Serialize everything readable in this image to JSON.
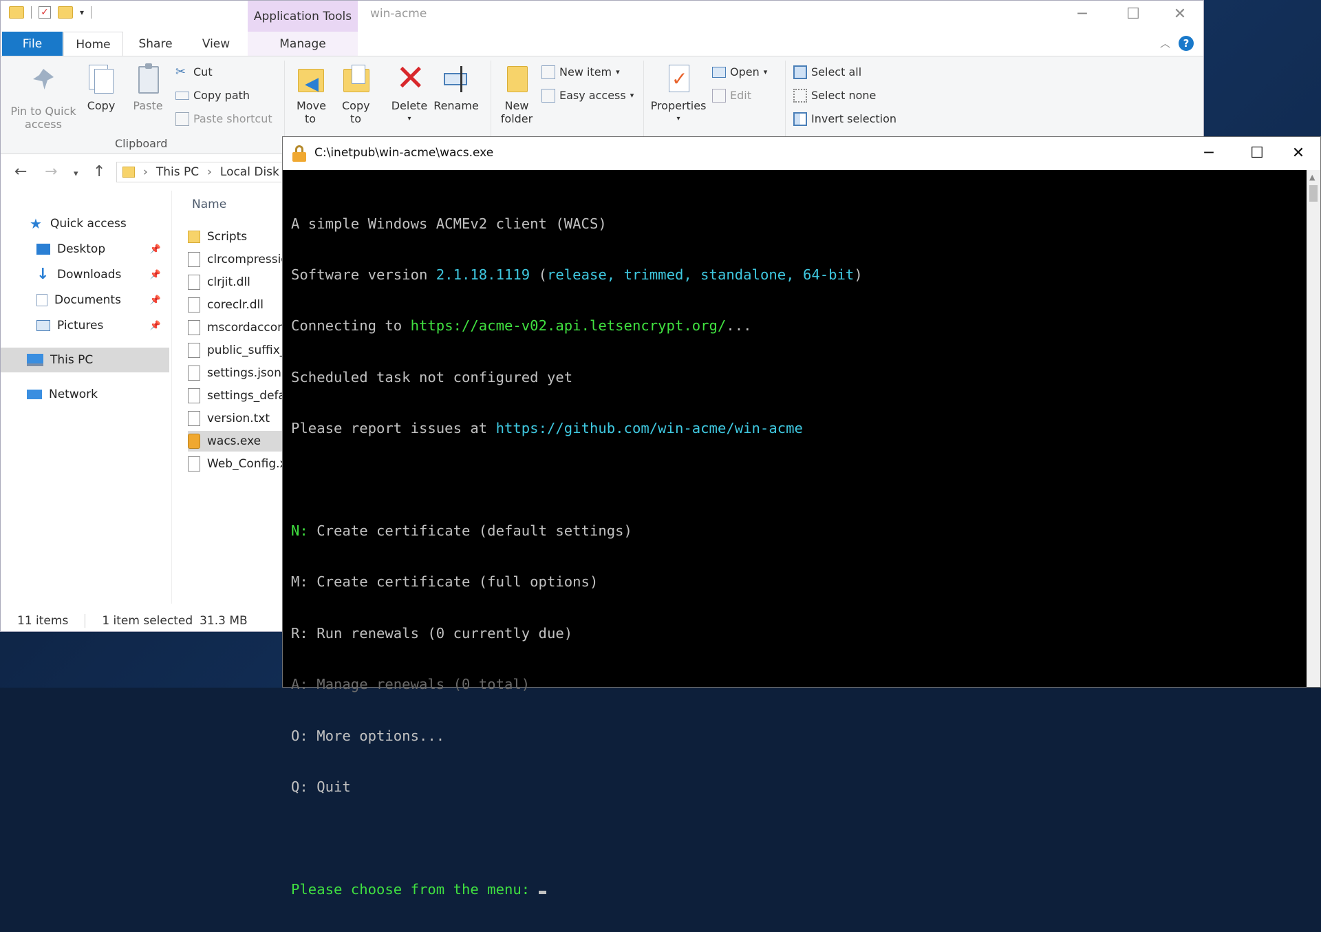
{
  "explorer": {
    "context_tab": "Application Tools",
    "window_title": "win-acme",
    "tabs": [
      "File",
      "Home",
      "Share",
      "View",
      "Manage"
    ],
    "ribbon": {
      "clipboard": {
        "pin_label": "Pin to Quick access",
        "copy_label": "Copy",
        "paste_label": "Paste",
        "cut_label": "Cut",
        "copy_path_label": "Copy path",
        "paste_shortcut_label": "Paste shortcut",
        "group_label": "Clipboard"
      },
      "organize": {
        "move_to_label": "Move to",
        "copy_to_label": "Copy to",
        "delete_label": "Delete",
        "rename_label": "Rename"
      },
      "new": {
        "new_folder_label": "New folder",
        "new_item_label": "New item",
        "easy_access_label": "Easy access"
      },
      "open": {
        "properties_label": "Properties",
        "open_label": "Open",
        "edit_label": "Edit"
      },
      "select": {
        "select_all_label": "Select all",
        "select_none_label": "Select none",
        "invert_label": "Invert selection"
      }
    },
    "address": {
      "segments": [
        "This PC",
        "Local Disk"
      ]
    },
    "nav": {
      "quick_access": "Quick access",
      "desktop": "Desktop",
      "downloads": "Downloads",
      "documents": "Documents",
      "pictures": "Pictures",
      "this_pc": "This PC",
      "network": "Network"
    },
    "file_list": {
      "column_name": "Name",
      "files": [
        "Scripts",
        "clrcompression.dll",
        "clrjit.dll",
        "coreclr.dll",
        "mscordaccore.dll",
        "public_suffix_list.dat",
        "settings.json",
        "settings_default.json",
        "version.txt",
        "wacs.exe",
        "Web_Config.xml"
      ]
    },
    "status": {
      "items": "11 items",
      "selected": "1 item selected",
      "size": "31.3 MB"
    }
  },
  "console": {
    "title": "C:\\inetpub\\win-acme\\wacs.exe",
    "lines": {
      "l1": "A simple Windows ACMEv2 client (WACS)",
      "l2_prefix": "Software version ",
      "l2_version": "2.1.18.1119",
      "l2_open": " (",
      "l2_detail": "release, trimmed, standalone, 64-bit",
      "l2_close": ")",
      "l3_prefix": "Connecting to ",
      "l3_url": "https://acme-v02.api.letsencrypt.org/",
      "l3_suffix": "...",
      "l4": "Scheduled task not configured yet",
      "l5_prefix": "Please report issues at ",
      "l5_url": "https://github.com/win-acme/win-acme",
      "m_n_key": "N:",
      "m_n_text": " Create certificate (default settings)",
      "m_m": "M: Create certificate (full options)",
      "m_r": "R: Run renewals (0 currently due)",
      "m_a": "A: Manage renewals (0 total)",
      "m_o": "O: More options...",
      "m_q": "Q: Quit",
      "prompt": "Please choose from the menu: "
    }
  }
}
